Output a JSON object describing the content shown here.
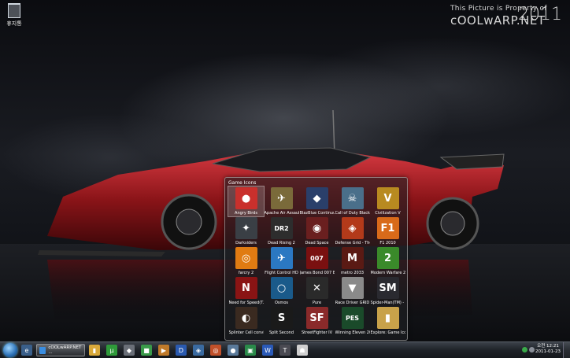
{
  "desktop": {
    "recycle_bin_label": "휴지통",
    "watermark_line1": "This Picture is Property of",
    "watermark_line2": "cOOLwARP.NET",
    "watermark_year": "2011"
  },
  "popup": {
    "title": "Game Icons",
    "items": [
      {
        "label": "Angry Birds",
        "glyph": "●",
        "color": "#c9302c",
        "selected": true
      },
      {
        "label": "Apache Air Assault",
        "glyph": "✈",
        "color": "#7a6a3a",
        "selected": false
      },
      {
        "label": "BlazBlue Continuu...",
        "glyph": "◆",
        "color": "#2a3f6a",
        "selected": false
      },
      {
        "label": "Call of Duty Black ...",
        "glyph": "☠",
        "color": "#4a6f8a",
        "selected": false
      },
      {
        "label": "Civilization V",
        "glyph": "V",
        "color": "#b88a20",
        "selected": false
      },
      {
        "label": "Darksiders",
        "glyph": "✦",
        "color": "#3a3f45",
        "selected": false
      },
      {
        "label": "Dead Rising 2",
        "glyph": "DR2",
        "color": "#2d2d2d",
        "selected": false
      },
      {
        "label": "Dead Space",
        "glyph": "◉",
        "color": "#6a1f1f",
        "selected": false
      },
      {
        "label": "Defense Grid - The...",
        "glyph": "◈",
        "color": "#b33a1a",
        "selected": false
      },
      {
        "label": "F1 2010",
        "glyph": "F1",
        "color": "#d86a1a",
        "selected": false
      },
      {
        "label": "farcry 2",
        "glyph": "◎",
        "color": "#e07b12",
        "selected": false
      },
      {
        "label": "Flight Control HD",
        "glyph": "✈",
        "color": "#2b78c2",
        "selected": false
      },
      {
        "label": "James Bond 007 Bl...",
        "glyph": "007",
        "color": "#7a1010",
        "selected": false
      },
      {
        "label": "metro 2033",
        "glyph": "M",
        "color": "#5a1a14",
        "selected": false
      },
      {
        "label": "Modern Warfare 2",
        "glyph": "2",
        "color": "#3a8a2a",
        "selected": false
      },
      {
        "label": "Need for Speed(T...",
        "glyph": "N",
        "color": "#8a1414",
        "selected": false
      },
      {
        "label": "Osmos",
        "glyph": "○",
        "color": "#1a5a8a",
        "selected": false
      },
      {
        "label": "Pure",
        "glyph": "✕",
        "color": "#2a2a2a",
        "selected": false
      },
      {
        "label": "Race Driver GRID",
        "glyph": "▼",
        "color": "#8a8a8a",
        "selected": false
      },
      {
        "label": "Spider-Man(TM) - ...",
        "glyph": "SM",
        "color": "#2a2a30",
        "selected": false
      },
      {
        "label": "Splinter Cell convic...",
        "glyph": "◐",
        "color": "#3a2a20",
        "selected": false
      },
      {
        "label": "Split Second",
        "glyph": "S",
        "color": "#1a1a1a",
        "selected": false
      },
      {
        "label": "StreetFighter IV",
        "glyph": "SF",
        "color": "#8a2a2a",
        "selected": false
      },
      {
        "label": "Winning Eleven 20...",
        "glyph": "PES",
        "color": "#1a4a2a",
        "selected": false
      },
      {
        "label": "Explore: Game Ico...",
        "glyph": "▮",
        "color": "#c8a24a",
        "selected": false
      }
    ]
  },
  "taskbar": {
    "active_window_label": "cOOLwARP.NET ...",
    "pinned_icons": [
      {
        "name": "folder-icon",
        "color": "#d9a93a",
        "glyph": "▮"
      },
      {
        "name": "torrent-icon",
        "color": "#2f9a3a",
        "glyph": "µ"
      },
      {
        "name": "gamepad-icon",
        "color": "#6a6f78",
        "glyph": "◆"
      },
      {
        "name": "green-app-icon",
        "color": "#3a9a4a",
        "glyph": "■"
      },
      {
        "name": "media-player-icon",
        "color": "#c07a2a",
        "glyph": "▶"
      },
      {
        "name": "d-app-icon",
        "color": "#2a5ab0",
        "glyph": "D"
      },
      {
        "name": "network-app-icon",
        "color": "#3a6aa0",
        "glyph": "◈"
      },
      {
        "name": "swirl-app-icon",
        "color": "#c0502a",
        "glyph": "◎"
      },
      {
        "name": "orb-app-icon",
        "color": "#5a7a9a",
        "glyph": "●"
      },
      {
        "name": "monitor-app-icon",
        "color": "#2a8a4a",
        "glyph": "▣"
      },
      {
        "name": "word-icon",
        "color": "#2a5ab8",
        "glyph": "W"
      },
      {
        "name": "text-app-icon",
        "color": "#4a4a52",
        "glyph": "T"
      },
      {
        "name": "stormtrooper-icon",
        "color": "#d0d0d0",
        "glyph": "☗"
      }
    ],
    "clock_time": "오전 12:21",
    "clock_date": "2011-01-23"
  }
}
